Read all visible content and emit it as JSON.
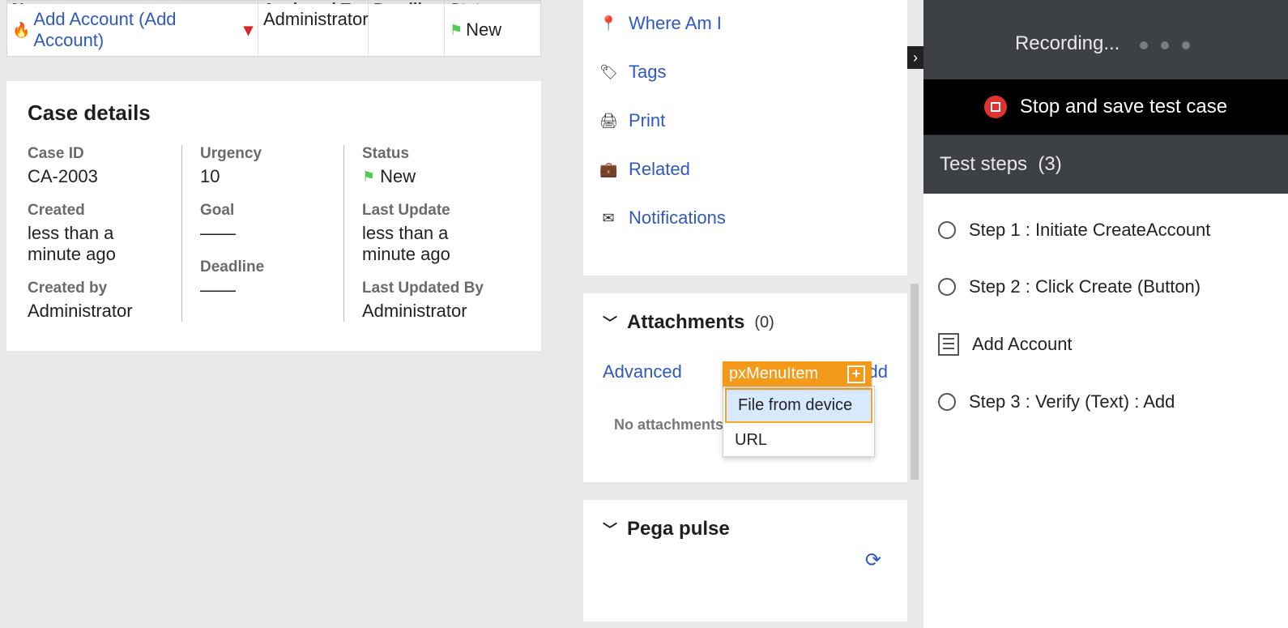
{
  "assignments": {
    "headers": {
      "name": "Name",
      "assigned": "Assigned To",
      "deadline": "Deadline",
      "status": "Status"
    },
    "row": {
      "link": "Add Account (Add Account)",
      "assigned": "Administrator",
      "status": "New"
    }
  },
  "caseDetails": {
    "title": "Case details",
    "labels": {
      "caseId": "Case ID",
      "urgency": "Urgency",
      "status": "Status",
      "created": "Created",
      "goal": "Goal",
      "lastUpdate": "Last Update",
      "deadline": "Deadline",
      "createdBy": "Created by",
      "lastUpdatedBy": "Last Updated By"
    },
    "values": {
      "caseId": "CA-2003",
      "urgency": "10",
      "status": "New",
      "created": "less than a minute ago",
      "goal": "——",
      "lastUpdate": "less than a minute ago",
      "deadline": "——",
      "createdBy": "Administrator",
      "lastUpdatedBy": "Administrator"
    }
  },
  "sideNav": {
    "where": "Where Am I",
    "tags": "Tags",
    "print": "Print",
    "related": "Related",
    "notifications": "Notifications"
  },
  "attachments": {
    "title": "Attachments",
    "count": "(0)",
    "advanced": "Advanced",
    "add": "Add",
    "tooltip": "pxMenuItem",
    "menu": {
      "file": "File from device",
      "url": "URL"
    },
    "empty": "No attachments"
  },
  "pulse": {
    "title": "Pega pulse"
  },
  "recorder": {
    "recording": "Recording...",
    "stop": "Stop and save test case",
    "stepsTitle": "Test steps",
    "stepsCount": "(3)",
    "steps": {
      "s1": "Step 1 : Initiate CreateAccount",
      "s2": "Step 2 : Click Create (Button)",
      "s3": "Add Account",
      "s4": "Step 3 : Verify (Text) : Add"
    }
  }
}
